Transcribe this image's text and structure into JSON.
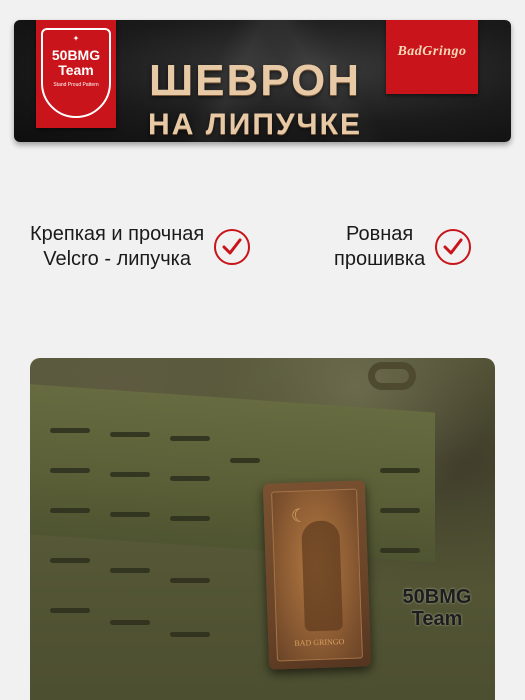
{
  "banner": {
    "badge_left": {
      "line1": "50BMG",
      "line2": "Team",
      "line3": "Stand Proud Pattern"
    },
    "badge_right": {
      "logo": "BadGringo"
    },
    "title_line1": "ШЕВРОН",
    "title_line2": "НА ЛИПУЧКЕ"
  },
  "features": [
    {
      "line1": "Крепкая и прочная",
      "line2": "Velcro - липучка"
    },
    {
      "line1": "Ровная",
      "line2": "прошивка"
    }
  ],
  "photo": {
    "patch_label": "BAD GRINGO",
    "watermark_line1": "50BMG",
    "watermark_line2": "Team"
  },
  "colors": {
    "accent_red": "#c8141a",
    "title_gold": "#e8c9a6"
  }
}
